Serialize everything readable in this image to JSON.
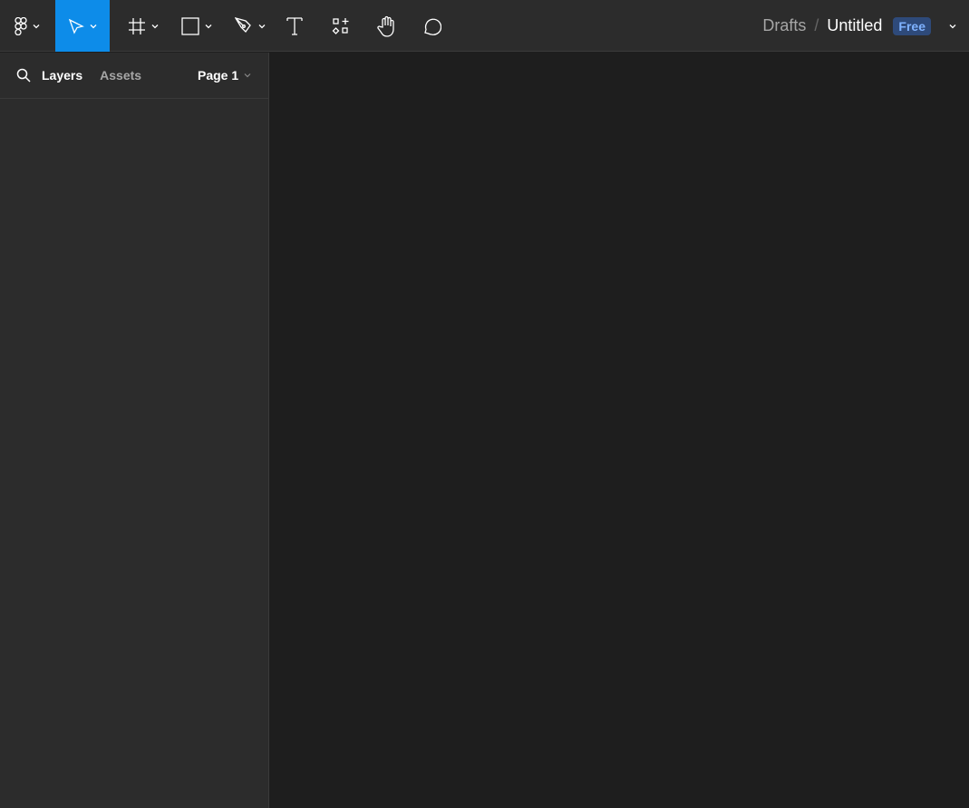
{
  "toolbar": {
    "tools": [
      "main-menu",
      "move",
      "frame",
      "shape",
      "pen",
      "text",
      "resources",
      "hand",
      "comment"
    ],
    "active_color": "#0d8ce9"
  },
  "breadcrumb": {
    "folder": "Drafts",
    "separator": "/",
    "file": "Untitled",
    "plan_badge": "Free"
  },
  "sidebar": {
    "tabs": [
      {
        "label": "Layers"
      },
      {
        "label": "Assets"
      }
    ],
    "page": "Page 1"
  }
}
